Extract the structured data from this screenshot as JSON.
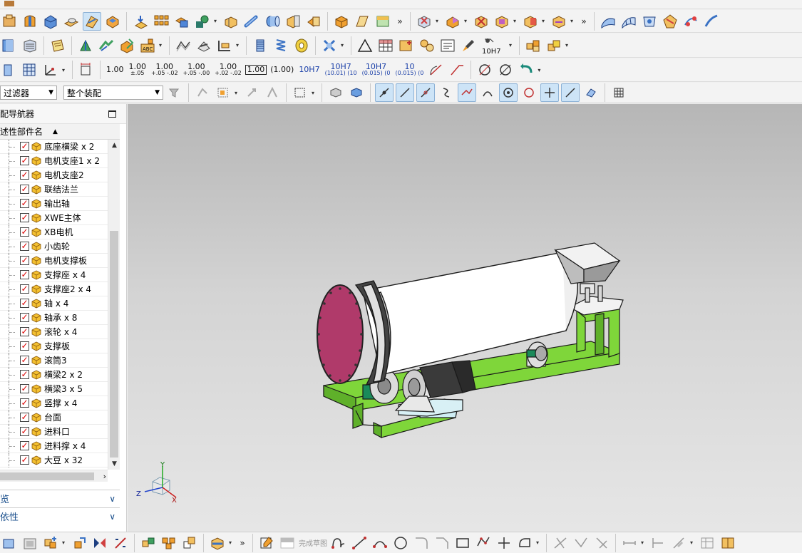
{
  "toolbar3": {
    "tolerances": [
      {
        "main": "1.00",
        "sub": ""
      },
      {
        "main": "1.00",
        "sub": "±.05"
      },
      {
        "main": "1.00",
        "sub": "+.05 -.02"
      },
      {
        "main": "1.00",
        "sub": "+.05 -.00"
      },
      {
        "main": "1.00",
        "sub": "+.02 -.02"
      }
    ],
    "boxed1": "1.00",
    "paren1": "(1.00)",
    "fits": [
      {
        "main": "10H7",
        "sub": ""
      },
      {
        "main": "10H7",
        "sub": "(10.01) (10"
      },
      {
        "main": "10H7",
        "sub": "(0.015) (0"
      },
      {
        "main": "10",
        "sub": "(0.015) (0"
      }
    ],
    "fit_label": "10H7"
  },
  "selection_bar": {
    "filter": "过滤器",
    "scope": "整个装配"
  },
  "navigator": {
    "title": "配导航器",
    "column": "述性部件名",
    "parts": [
      "底座横梁 x 2",
      "电机支座1 x 2",
      "电机支座2",
      "联结法兰",
      "输出轴",
      "XWE主体",
      "XB电机",
      "小齿轮",
      "电机支撑板",
      "支撑座 x 4",
      "支撑座2 x 4",
      "轴 x 4",
      "轴承 x 8",
      "滚轮 x 4",
      "支撑板",
      "滚筒3",
      "横梁2 x 2",
      "横梁3 x 5",
      "竖撑 x 4",
      "台面",
      "进料口",
      "进料撑 x 4",
      "大豆 x 32"
    ],
    "panels": [
      "览",
      "依性"
    ]
  },
  "triad": {
    "x": "X",
    "y": "Y",
    "z": "Z"
  },
  "bottom_bar": {
    "sketch_done": "完成草图"
  },
  "colors": {
    "accent": "#1a4f8c",
    "frame_green": "#7fd63a",
    "flange": "#b03a6a",
    "drum": "#ffffff",
    "check": "#d00000"
  }
}
